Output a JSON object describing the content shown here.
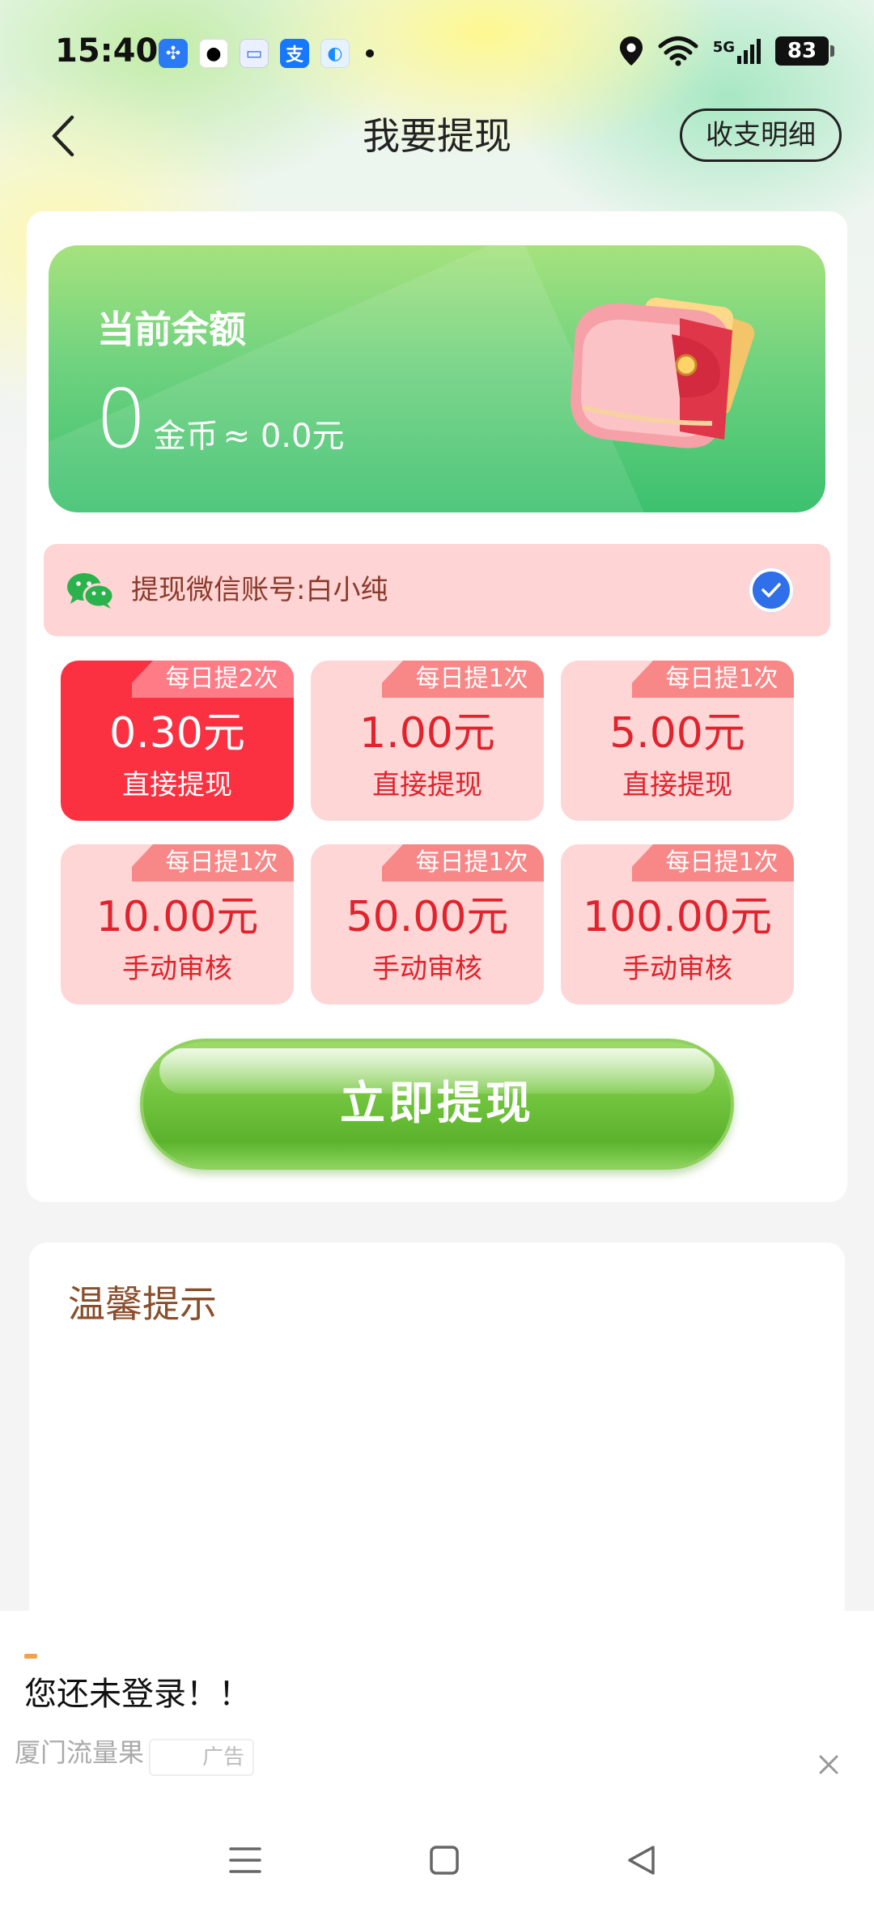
{
  "status_bar": {
    "time": "15:40",
    "notification_icons": [
      "pinwheel-app-icon",
      "qq-icon",
      "message-app-icon",
      "alipay-icon",
      "browser-app-icon"
    ],
    "network": "5G",
    "battery": "83"
  },
  "header": {
    "title": "我要提现",
    "details_label": "收支明细"
  },
  "balance": {
    "label": "当前余额",
    "coins": "0",
    "coin_unit": "金币",
    "approx": "≈ 0.0元"
  },
  "account": {
    "label": "提现微信账号:白小纯",
    "selected": true
  },
  "options": [
    {
      "badge": "每日提2次",
      "amount": "0.30元",
      "type": "直接提现",
      "selected": true
    },
    {
      "badge": "每日提1次",
      "amount": "1.00元",
      "type": "直接提现",
      "selected": false
    },
    {
      "badge": "每日提1次",
      "amount": "5.00元",
      "type": "直接提现",
      "selected": false
    },
    {
      "badge": "每日提1次",
      "amount": "10.00元",
      "type": "手动审核",
      "selected": false
    },
    {
      "badge": "每日提1次",
      "amount": "50.00元",
      "type": "手动审核",
      "selected": false
    },
    {
      "badge": "每日提1次",
      "amount": "100.00元",
      "type": "手动审核",
      "selected": false
    }
  ],
  "withdraw_button": "立即提现",
  "tips": {
    "title": "温馨提示"
  },
  "ad": {
    "title": "您还未登录！！",
    "source": "厦门流量果",
    "tag": "广告"
  },
  "colors": {
    "accent_green": "#5bb22c",
    "selected_red": "#fb3142",
    "option_pink": "#ffd6d6",
    "check_blue": "#2f6fe9"
  }
}
